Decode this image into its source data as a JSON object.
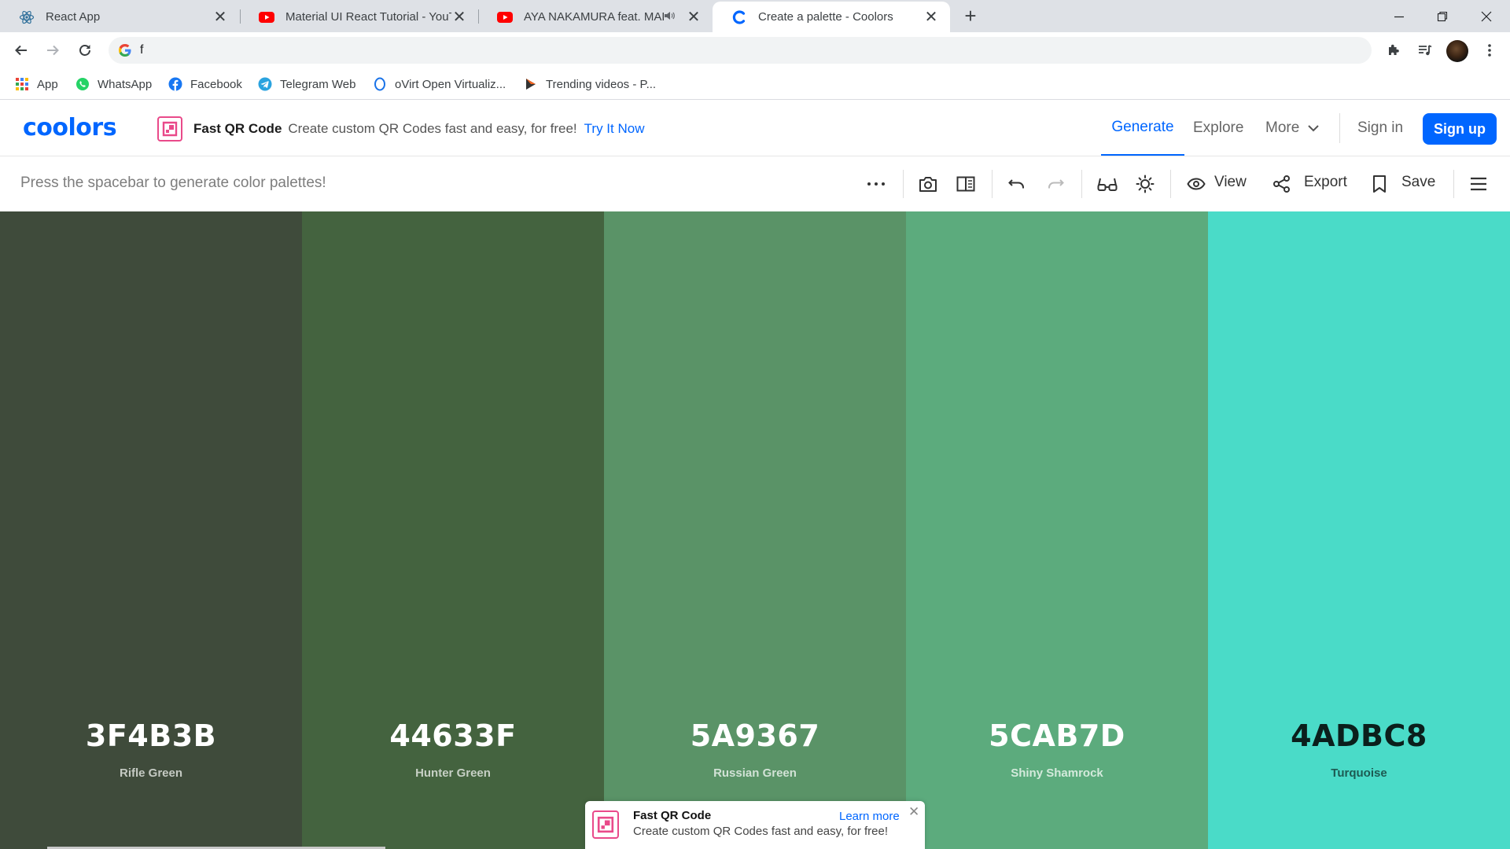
{
  "browser": {
    "tabs": [
      {
        "title": "React App",
        "icon": "react-icon"
      },
      {
        "title": "Material UI React Tutorial - YouTube",
        "icon": "youtube-icon"
      },
      {
        "title": "AYA NAKAMURA feat. MALUMA",
        "icon": "youtube-icon",
        "muted_indicator": "speaker-icon"
      },
      {
        "title": "Create a palette - Coolors",
        "icon": "coolors-icon",
        "active": true
      }
    ],
    "close_symbol": "✕",
    "new_tab_symbol": "+",
    "address": "f",
    "bookmarks": [
      {
        "label": "App",
        "icon": "apps-grid-icon"
      },
      {
        "label": "WhatsApp",
        "icon": "whatsapp-icon"
      },
      {
        "label": "Facebook",
        "icon": "facebook-icon"
      },
      {
        "label": "Telegram Web",
        "icon": "telegram-icon"
      },
      {
        "label": "oVirt Open Virtualiz...",
        "icon": "ovirt-icon"
      },
      {
        "label": "Trending videos - P...",
        "icon": "play-icon"
      }
    ]
  },
  "site": {
    "logo": "coolors",
    "promo": {
      "title": "Fast QR Code",
      "description": "Create custom QR Codes fast and easy, for free!",
      "link": "Try It Now"
    },
    "nav": {
      "generate": "Generate",
      "explore": "Explore",
      "more": "More",
      "sign_in": "Sign in",
      "sign_up": "Sign up"
    },
    "brand_color": "#0066ff"
  },
  "generator": {
    "hint": "Press the spacebar to generate color palettes!",
    "view_label": "View",
    "export_label": "Export",
    "save_label": "Save"
  },
  "palette": [
    {
      "hex": "3F4B3B",
      "name": "Rifle Green",
      "color": "#3F4B3B",
      "text_color": "#ffffff",
      "name_color": "#c5cac3"
    },
    {
      "hex": "44633F",
      "name": "Hunter Green",
      "color": "#44633F",
      "text_color": "#ffffff",
      "name_color": "#c7d0c5"
    },
    {
      "hex": "5A9367",
      "name": "Russian Green",
      "color": "#5A9367",
      "text_color": "#ffffff",
      "name_color": "#d2e2d6"
    },
    {
      "hex": "5CAB7D",
      "name": "Shiny Shamrock",
      "color": "#5CAB7D",
      "text_color": "#ffffff",
      "name_color": "#d4eadc"
    },
    {
      "hex": "4ADBC8",
      "name": "Turquoise",
      "color": "#4ADBC8",
      "text_color": "#0b1f1c",
      "name_color": "#1d5a52"
    }
  ],
  "ad": {
    "title": "Fast QR Code",
    "description": "Create custom QR Codes fast and easy, for free!",
    "link": "Learn more",
    "close": "✕"
  }
}
